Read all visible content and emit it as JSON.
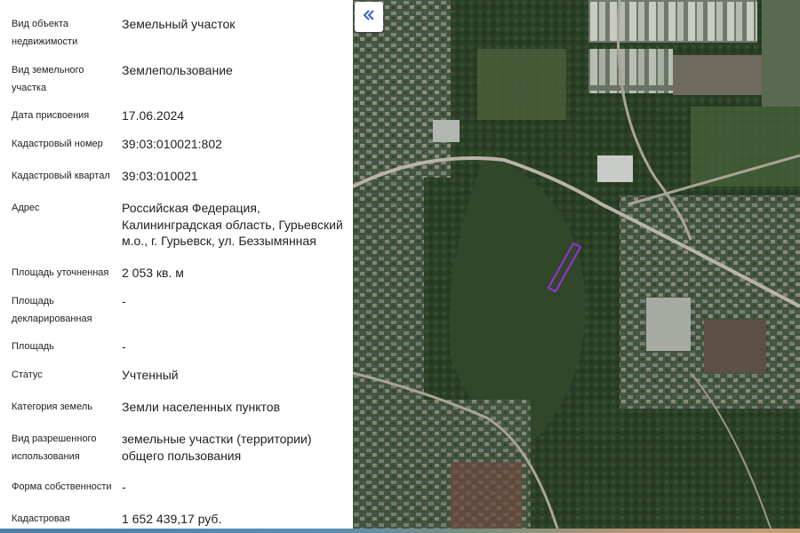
{
  "details": {
    "rows": [
      {
        "label": "Вид объекта недвижимости",
        "value": "Земельный участок"
      },
      {
        "label": "Вид земельного участка",
        "value": "Землепользование"
      },
      {
        "label": "Дата присвоения",
        "value": "17.06.2024"
      },
      {
        "label": "Кадастровый номер",
        "value": "39:03:010021:802"
      },
      {
        "label": "Кадастровый квартал",
        "value": "39:03:010021"
      },
      {
        "label": "Адрес",
        "value": "Российская Федерация, Калининградская область, Гурьевский м.о., г. Гурьевск, ул. Беззымянная"
      },
      {
        "label": "Площадь уточненная",
        "value": "2 053 кв. м"
      },
      {
        "label": "Площадь декларированная",
        "value": "-"
      },
      {
        "label": "Площадь",
        "value": "-"
      },
      {
        "label": "Статус",
        "value": "Учтенный"
      },
      {
        "label": "Категория земель",
        "value": "Земли населенных пунктов"
      },
      {
        "label": "Вид разрешенного использования",
        "value": "земельные участки (территории) общего пользования"
      },
      {
        "label": "Форма собственности",
        "value": "-"
      },
      {
        "label": "Кадастровая",
        "value": "1 652 439,17 руб."
      }
    ]
  },
  "map": {
    "collapse_icon": "double-chevron-left-icon",
    "parcel_color": "#9b30d9",
    "accent_color": "#3b63c4"
  }
}
